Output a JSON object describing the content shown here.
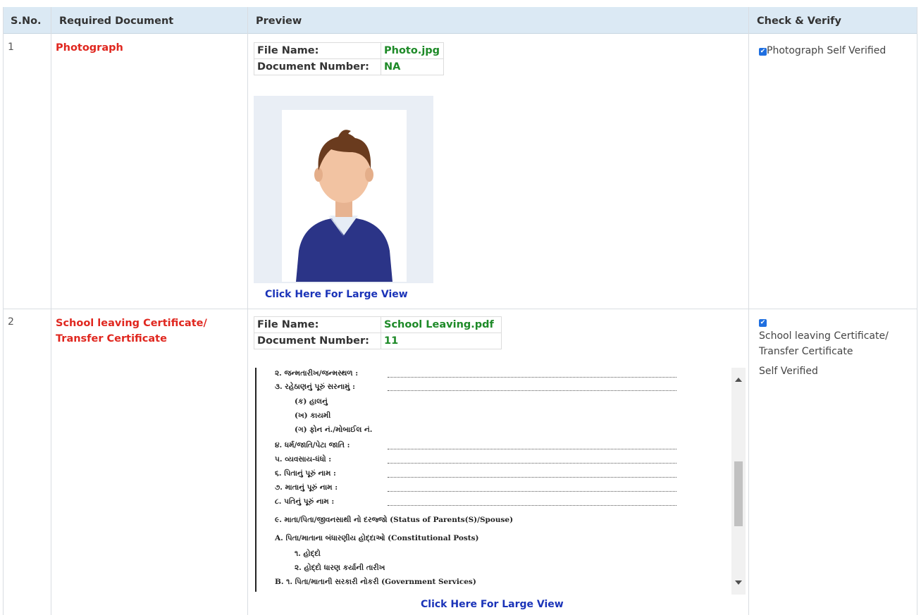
{
  "header": {
    "sno": "S.No.",
    "required_document": "Required Document",
    "preview": "Preview",
    "check_verify": "Check & Verify"
  },
  "rows": [
    {
      "sno": "1",
      "document": "Photograph",
      "file_name_label": "File Name:",
      "file_name": "Photo.jpg",
      "doc_number_label": "Document Number:",
      "doc_number": "NA",
      "large_view": "Click Here For Large View",
      "verify_text": "Photograph Self Verified",
      "checked": true
    },
    {
      "sno": "2",
      "document_line1": "School leaving Certificate/",
      "document_line2": "Transfer Certificate",
      "file_name_label": "File Name:",
      "file_name": "School Leaving.pdf",
      "doc_number_label": "Document Number:",
      "doc_number": "11",
      "large_view": "Click Here For Large View",
      "verify_line1": "School leaving Certificate/",
      "verify_line2": "Transfer Certificate",
      "verify_line3": "Self Verified",
      "checked": true
    }
  ],
  "doc_preview_lines": [
    "૨. જન્મતારીખ/જન્મસ્થળ :",
    "૩. રહેઠાણનું પૂરું સરનામું :",
    "(ક) હાલનું",
    "(ખ) કાયમી",
    "(ગ) ફોન નં./મોબાઈલ નં.",
    "૪. ધર્મ/જાતિ/પેટા જાતિ :",
    "૫. વ્યવસાય-ધંધો :",
    "૬. પિતાનું પૂરું નામ :",
    "૭. માતાનું પૂરું નામ :",
    "૮. પતિનું પૂરું નામ :",
    "૯. માતા/પિતા/જીવનસાથી નો દરજ્જો (Status of Parents(S)/Spouse)",
    "A. પિતા/માતાના બંધારણીય હોદ્દાઓ (Constitutional Posts)",
    "૧. હોદ્દો",
    "૨. હોદ્દો ધારણ કર્યાની તારીખ",
    "B. ૧. પિતા/માતાની સરકારી નોકરી (Government Services)"
  ]
}
